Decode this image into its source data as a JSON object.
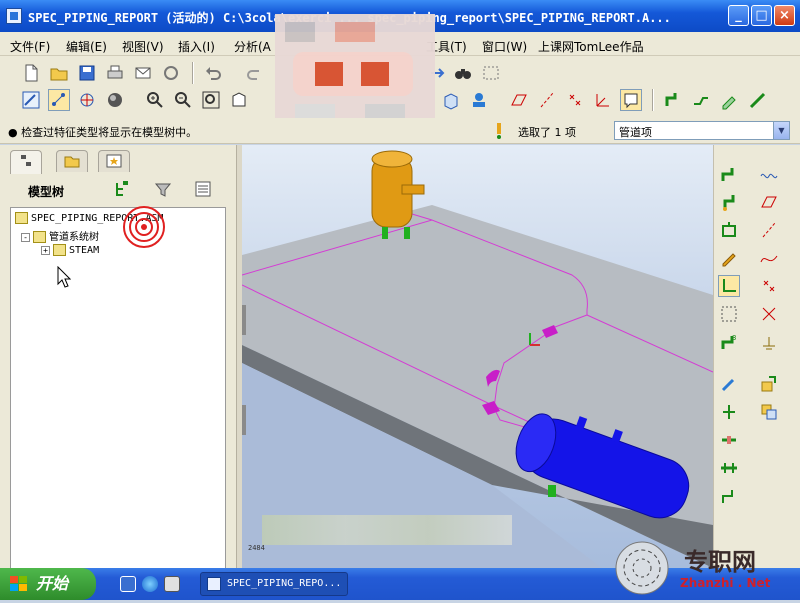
{
  "window": {
    "title": "SPEC_PIPING_REPORT (活动的) C:\\3cola\\exerci ... spec_piping_report\\SPEC_PIPING_REPORT.A...",
    "min": "_",
    "max": "□",
    "close": "×"
  },
  "menu": [
    "文件(F)",
    "编辑(E)",
    "视图(V)",
    "插入(I)",
    "分析(A",
    "工具(T)",
    "窗口(W)",
    "上课网TomLee作品"
  ],
  "status": {
    "message": "● 检查过特征类型将显示在模型树中。",
    "selected": "选取了 1 项",
    "filter": "管道项"
  },
  "left_panel": {
    "title": "模型树",
    "tree": [
      {
        "label": "SPEC_PIPING_REPORT.ASM",
        "level": 0
      },
      {
        "label": "管道系统树",
        "level": 1,
        "expander": "-"
      },
      {
        "label": "STEAM",
        "level": 2,
        "expander": "+"
      }
    ]
  },
  "viewport": {
    "corner_label": "2484"
  },
  "taskbar": {
    "start": "开始",
    "task": "SPEC_PIPING_REPO...",
    "watermark": "专职网",
    "watermark_url": "Zhanzhi . Net"
  },
  "colors": {
    "pipe": "#d43cd4",
    "vessel_orange": "#e09a14",
    "vessel_blue": "#1414e8",
    "fitting": "#c81ec8",
    "support": "#20b020"
  }
}
